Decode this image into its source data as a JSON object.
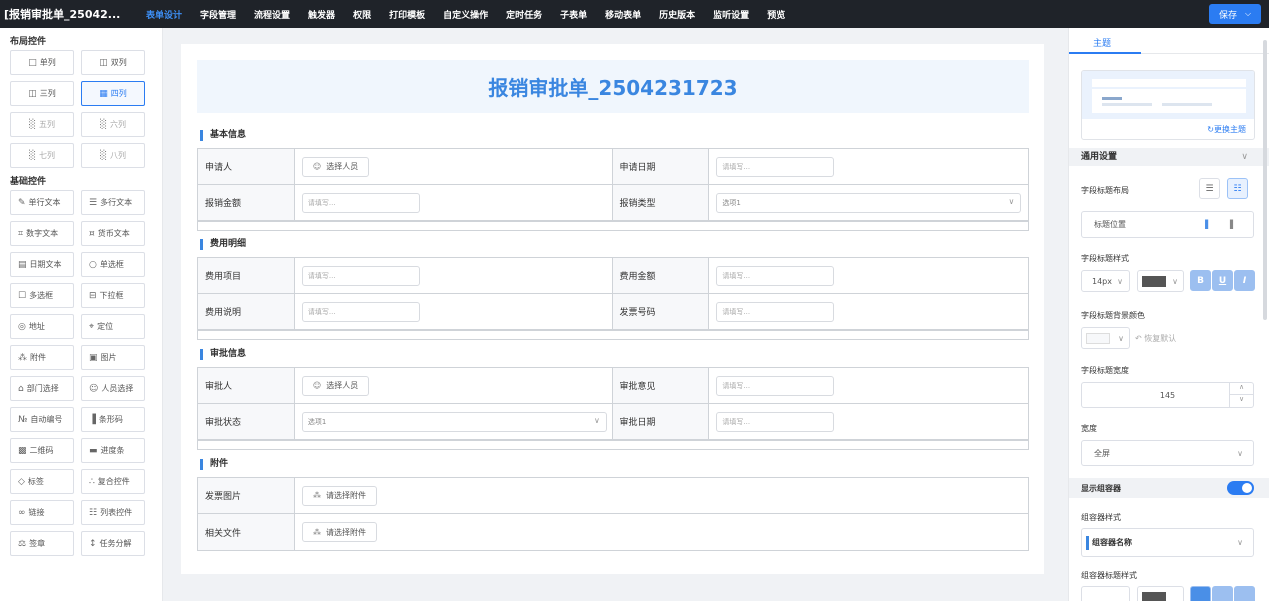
{
  "app": {
    "title": "[报销审批单_25042..."
  },
  "nav": {
    "items": [
      "表单设计",
      "字段管理",
      "流程设置",
      "触发器",
      "权限",
      "打印模板",
      "自定义操作",
      "定时任务",
      "子表单",
      "移动表单",
      "历史版本",
      "监听设置",
      "预览"
    ],
    "active": "表单设计"
  },
  "save": {
    "label": "保存"
  },
  "left": {
    "layout_title": "布局控件",
    "layout_items": [
      {
        "label": "单列",
        "icon": "single-col-icon",
        "state": "normal"
      },
      {
        "label": "双列",
        "icon": "double-col-icon",
        "state": "normal"
      },
      {
        "label": "三列",
        "icon": "three-col-icon",
        "state": "normal"
      },
      {
        "label": "四列",
        "icon": "four-col-icon",
        "state": "selected"
      },
      {
        "label": "五列",
        "icon": "five-col-icon",
        "state": "dim"
      },
      {
        "label": "六列",
        "icon": "six-col-icon",
        "state": "dim"
      },
      {
        "label": "七列",
        "icon": "seven-col-icon",
        "state": "dim"
      },
      {
        "label": "八列",
        "icon": "eight-col-icon",
        "state": "dim"
      }
    ],
    "basic_title": "基础控件",
    "basic_items": [
      {
        "label": "单行文本",
        "icon": "single-text-icon"
      },
      {
        "label": "多行文本",
        "icon": "multi-text-icon"
      },
      {
        "label": "数字文本",
        "icon": "number-icon"
      },
      {
        "label": "货币文本",
        "icon": "currency-icon"
      },
      {
        "label": "日期文本",
        "icon": "calendar-icon"
      },
      {
        "label": "单选框",
        "icon": "radio-icon"
      },
      {
        "label": "多选框",
        "icon": "checkbox-icon"
      },
      {
        "label": "下拉框",
        "icon": "dropdown-icon"
      },
      {
        "label": "地址",
        "icon": "location-pin-icon"
      },
      {
        "label": "定位",
        "icon": "crosshair-icon"
      },
      {
        "label": "附件",
        "icon": "paperclip-icon"
      },
      {
        "label": "图片",
        "icon": "image-icon"
      },
      {
        "label": "部门选择",
        "icon": "department-icon"
      },
      {
        "label": "人员选择",
        "icon": "people-icon"
      },
      {
        "label": "自动编号",
        "icon": "auto-number-icon"
      },
      {
        "label": "条形码",
        "icon": "barcode-icon"
      },
      {
        "label": "二维码",
        "icon": "qrcode-icon"
      },
      {
        "label": "进度条",
        "icon": "progress-icon"
      },
      {
        "label": "标签",
        "icon": "tag-icon"
      },
      {
        "label": "复合控件",
        "icon": "composite-icon"
      },
      {
        "label": "链接",
        "icon": "link-icon"
      },
      {
        "label": "列表控件",
        "icon": "list-icon"
      },
      {
        "label": "签章",
        "icon": "seal-icon"
      },
      {
        "label": "任务分解",
        "icon": "task-split-icon"
      }
    ]
  },
  "form": {
    "title": "报销审批单_2504231723",
    "sections": [
      {
        "title": "基本信息",
        "rows": [
          [
            {
              "label": "申请人",
              "kind": "button",
              "value": "选择人员",
              "icon": "user-icon"
            },
            {
              "label": "申请日期",
              "kind": "input",
              "value": "请填写..."
            }
          ],
          [
            {
              "label": "报销金额",
              "kind": "input",
              "value": "请填写..."
            },
            {
              "label": "报销类型",
              "kind": "select",
              "value": "选项1"
            }
          ]
        ]
      },
      {
        "title": "费用明细",
        "rows": [
          [
            {
              "label": "费用项目",
              "kind": "input",
              "value": "请填写..."
            },
            {
              "label": "费用金额",
              "kind": "input",
              "value": "请填写..."
            }
          ],
          [
            {
              "label": "费用说明",
              "kind": "input",
              "value": "请填写..."
            },
            {
              "label": "发票号码",
              "kind": "input",
              "value": "请填写..."
            }
          ]
        ]
      },
      {
        "title": "审批信息",
        "rows": [
          [
            {
              "label": "审批人",
              "kind": "button",
              "value": "选择人员",
              "icon": "user-icon"
            },
            {
              "label": "审批意见",
              "kind": "input",
              "value": "请填写..."
            }
          ],
          [
            {
              "label": "审批状态",
              "kind": "select",
              "value": "选项1"
            },
            {
              "label": "审批日期",
              "kind": "input",
              "value": "请填写..."
            }
          ]
        ]
      },
      {
        "title": "附件",
        "rows": [
          [
            {
              "label": "发票图片",
              "kind": "attach",
              "value": "请选择附件",
              "icon": "paperclip-icon"
            }
          ],
          [
            {
              "label": "相关文件",
              "kind": "attach",
              "value": "请选择附件",
              "icon": "paperclip-icon"
            }
          ]
        ]
      }
    ]
  },
  "right": {
    "tab": "主题",
    "change_theme": "更换主题",
    "general": "通用设置",
    "field_title_layout": "字段标题布局",
    "title_position": "标题位置",
    "field_title_style": "字段标题样式",
    "font_size": "14px",
    "title_color": "#555555",
    "bold": "B",
    "underline": "U",
    "italic": "I",
    "field_title_bg": "字段标题背景颜色",
    "restore_default": "恢复默认",
    "field_title_width": "字段标题宽度",
    "width_value": "145",
    "width": "宽度",
    "width_option": "全屏",
    "show_container": "显示组容器",
    "show_container_on": true,
    "container_style": "组容器样式",
    "container_name": "组容器名称",
    "container_title_style": "组容器标题样式"
  }
}
